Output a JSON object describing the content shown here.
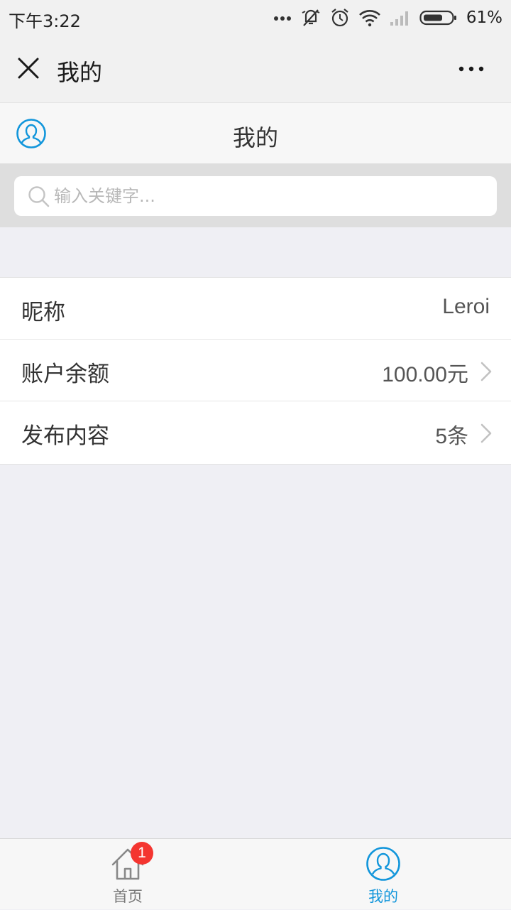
{
  "status_bar": {
    "time": "下午3:22",
    "battery_percent": "61%",
    "battery_level": 0.61,
    "icons": [
      "more-dots-icon",
      "vibrate-off-icon",
      "alarm-icon",
      "wifi-icon",
      "cellular-signal-icon",
      "battery-icon"
    ]
  },
  "nav": {
    "title": "我的",
    "close_icon": "close-icon",
    "more_icon": "more-icon"
  },
  "header": {
    "title": "我的",
    "icon": "user-avatar-icon",
    "accent_color": "#1296db"
  },
  "search": {
    "placeholder": "输入关键字...",
    "value": "",
    "icon": "search-icon"
  },
  "profile_rows": [
    {
      "label": "昵称",
      "value": "Leroi",
      "has_arrow": false
    },
    {
      "label": "账户余额",
      "value": "100.00元",
      "has_arrow": true
    },
    {
      "label": "发布内容",
      "value": "5条",
      "has_arrow": true
    }
  ],
  "tab_bar": {
    "tabs": [
      {
        "label": "首页",
        "icon": "home-icon",
        "badge": "1",
        "active": false
      },
      {
        "label": "我的",
        "icon": "user-icon",
        "active": true
      }
    ],
    "active_color": "#1296db",
    "inactive_color": "#777777",
    "badge_color": "#f43530"
  }
}
